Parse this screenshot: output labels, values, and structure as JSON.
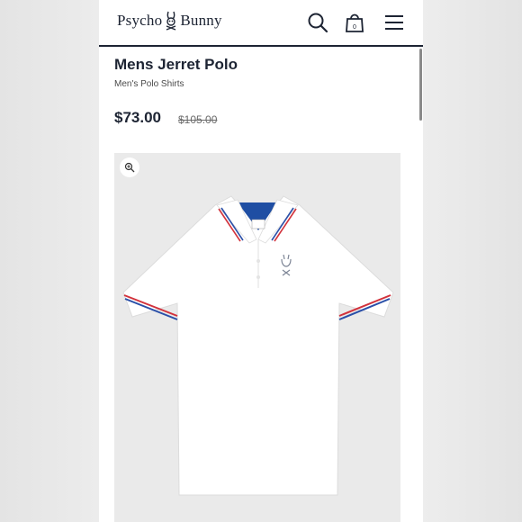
{
  "header": {
    "brand": "Psycho Bunny",
    "icons": [
      "search-icon",
      "shopping-bag-icon",
      "menu-icon"
    ]
  },
  "product": {
    "title": "Mens Jerret Polo",
    "category": "Men's Polo Shirts",
    "price": "$73.00",
    "original_price": "$105.00",
    "image": {
      "zoom_icon": "zoom-in-icon",
      "shirt_color": "#ffffff",
      "tipping_colors": [
        "#d2323c",
        "#ffffff",
        "#2a4fa8"
      ]
    }
  },
  "colors": {
    "brand_navy": "#1d2433",
    "image_background": "#eaeaea"
  }
}
